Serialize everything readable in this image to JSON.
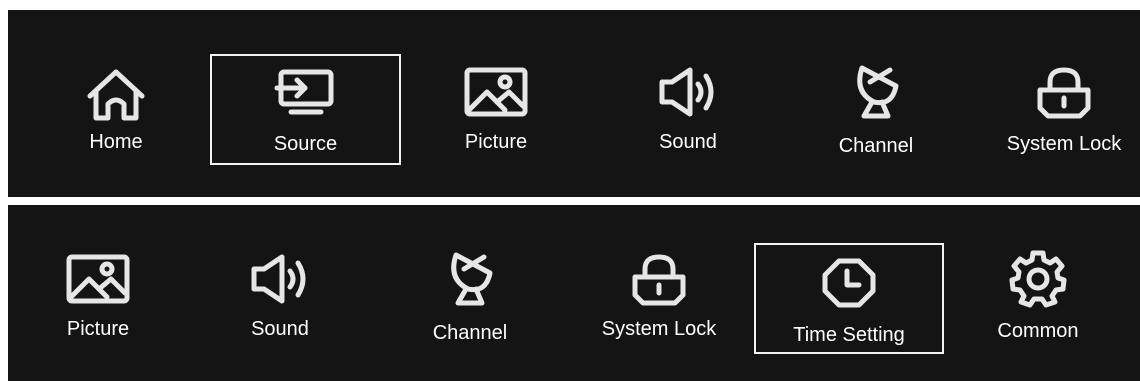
{
  "menu_top": {
    "items": [
      {
        "label": "Home",
        "icon": "home-icon"
      },
      {
        "label": "Source",
        "icon": "source-icon",
        "selected": true
      },
      {
        "label": "Picture",
        "icon": "picture-icon"
      },
      {
        "label": "Sound",
        "icon": "sound-icon"
      },
      {
        "label": "Channel",
        "icon": "satellite-dish-icon"
      },
      {
        "label": "System Lock",
        "icon": "lock-icon"
      }
    ]
  },
  "menu_bottom": {
    "items": [
      {
        "label": "Picture",
        "icon": "picture-icon"
      },
      {
        "label": "Sound",
        "icon": "sound-icon"
      },
      {
        "label": "Channel",
        "icon": "satellite-dish-icon"
      },
      {
        "label": "System Lock",
        "icon": "lock-icon"
      },
      {
        "label": "Time Setting",
        "icon": "clock-icon",
        "selected": true
      },
      {
        "label": "Common",
        "icon": "gear-icon"
      }
    ]
  },
  "colors": {
    "background": "#141414",
    "foreground": "#e6e6e6",
    "selection_border": "#f2f2f2"
  }
}
